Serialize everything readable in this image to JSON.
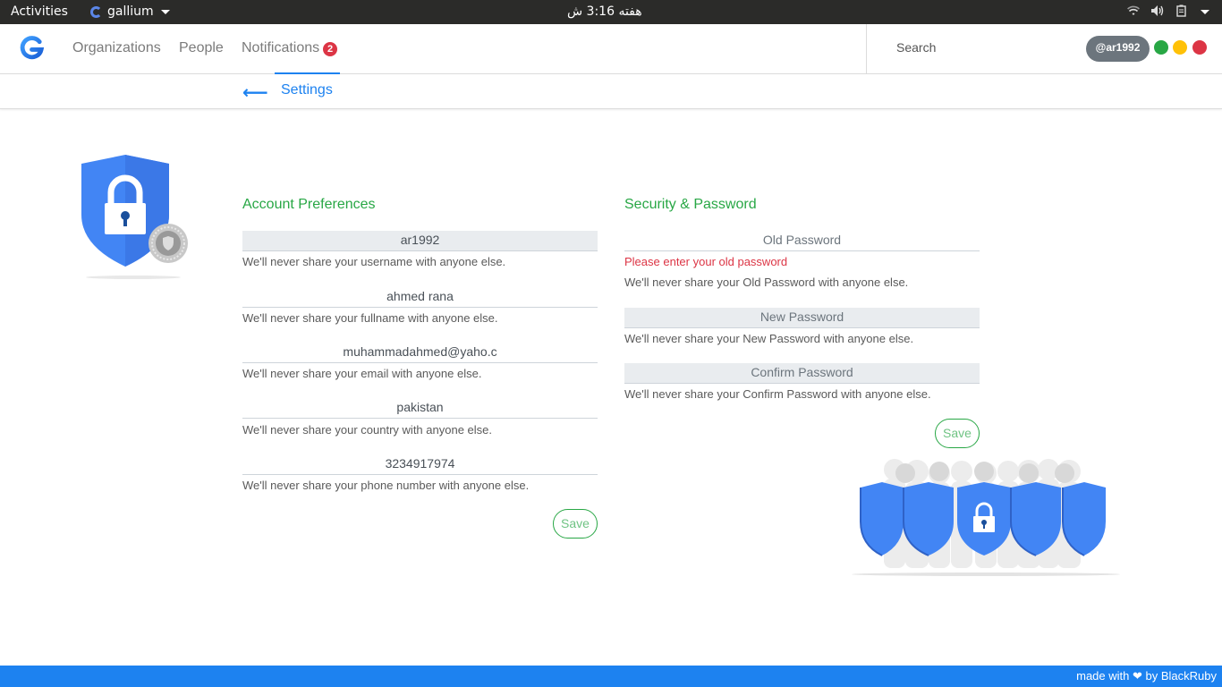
{
  "system_bar": {
    "activities": "Activities",
    "app_name": "gallium",
    "clock": "هفته 3:16 ش"
  },
  "header": {
    "nav": {
      "organizations": "Organizations",
      "people": "People",
      "notifications": "Notifications",
      "notification_count": "2"
    },
    "search_label": "Search",
    "user_handle": "@ar1992",
    "window_controls": [
      "green",
      "yellow",
      "red"
    ]
  },
  "subnav": {
    "back_icon": "left-arrow-icon",
    "active_tab": "Settings"
  },
  "account": {
    "title": "Account Preferences",
    "fields": [
      {
        "value": "ar1992",
        "hint": "We'll never share your username with anyone else."
      },
      {
        "value": "ahmed rana",
        "hint": "We'll never share your fullname with anyone else."
      },
      {
        "value": "muhammadahmed@yaho.c",
        "hint": "We'll never share your email with anyone else."
      },
      {
        "value": "pakistan",
        "hint": "We'll never share your country with anyone else."
      },
      {
        "value": "3234917974",
        "hint": "We'll never share your phone number with anyone else."
      }
    ],
    "save_label": "Save"
  },
  "security": {
    "title": "Security & Password",
    "fields": [
      {
        "placeholder": "Old Password",
        "error": "Please enter your old password",
        "hint": "We'll never share your Old Password with anyone else."
      },
      {
        "placeholder": "New Password",
        "hint": "We'll never share your New Password with anyone else."
      },
      {
        "placeholder": "Confirm Password",
        "hint": "We'll never share your Confirm Password with anyone else."
      }
    ],
    "save_label": "Save"
  },
  "footer": {
    "prefix": "made with",
    "suffix": "by BlackRuby"
  },
  "colors": {
    "accent": "#1d82f0",
    "success": "#28a745",
    "danger": "#dc3545",
    "shield": "#4285f4"
  }
}
